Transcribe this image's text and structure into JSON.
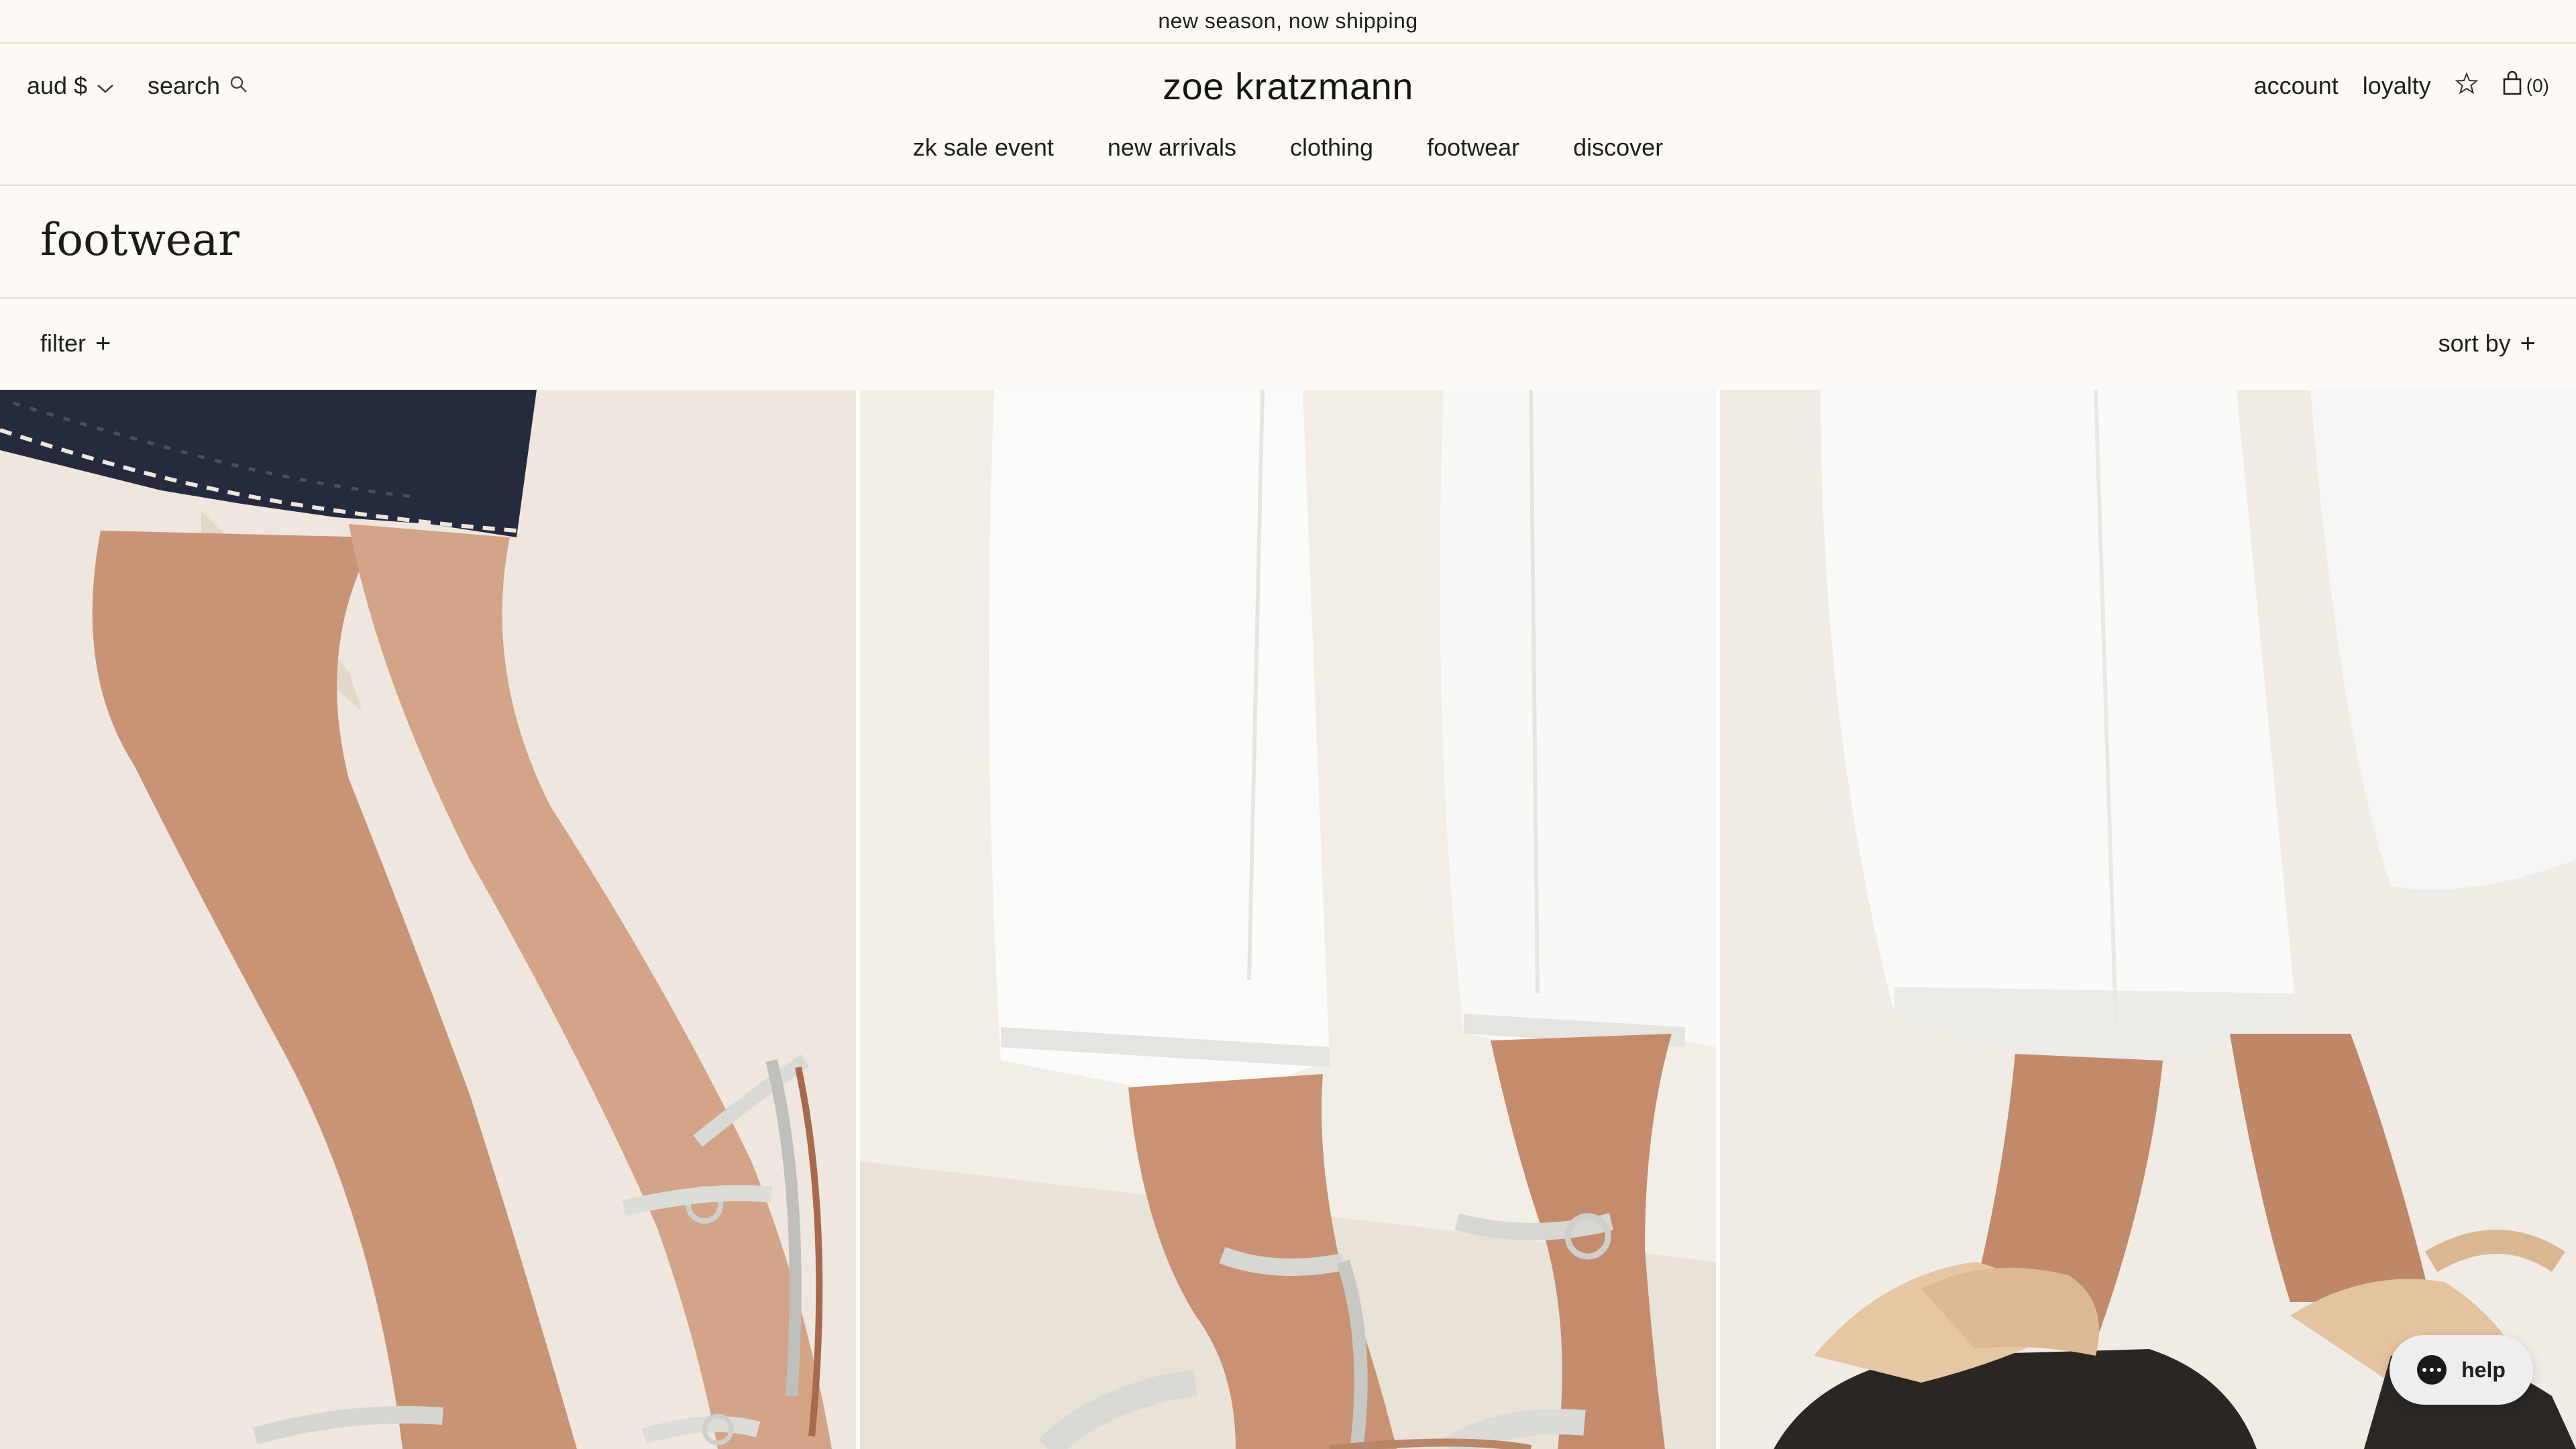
{
  "announcement": {
    "text": "new season, now shipping"
  },
  "header": {
    "currency": "aud $",
    "search_label": "search",
    "logo": "zoe kratzmann",
    "account_label": "account",
    "loyalty_label": "loyalty",
    "bag_count": "(0)"
  },
  "nav": {
    "items": [
      {
        "label": "zk sale event"
      },
      {
        "label": "new arrivals"
      },
      {
        "label": "clothing"
      },
      {
        "label": "footwear"
      },
      {
        "label": "discover"
      }
    ]
  },
  "page": {
    "title": "footwear",
    "filter_label": "filter",
    "sort_label": "sort by"
  },
  "products": [
    {
      "icon": "silver-strappy-sandal-lace-hem-image"
    },
    {
      "icon": "silver-ankle-strap-sandal-white-pants-image"
    },
    {
      "icon": "tan-woven-platform-sandal-image"
    }
  ],
  "help": {
    "label": "help"
  },
  "colors": {
    "background": "#fdfaf5",
    "divider": "#e4ded5",
    "text": "#1f1f1f",
    "help_pill": "#eeeeee"
  }
}
